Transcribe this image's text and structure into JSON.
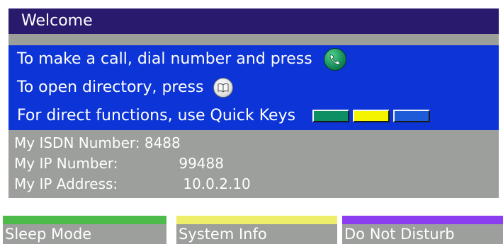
{
  "title": "Welcome",
  "instructions": {
    "call_text": "To make a call, dial number and press",
    "call_icon": "call-handset-icon",
    "directory_text": "To open directory, press",
    "directory_icon": "directory-book-icon",
    "quickkeys_text": "For direct functions, use Quick Keys",
    "quick_keys_colors": [
      "#0e8f63",
      "#f4f400",
      "#1d5bd8"
    ]
  },
  "info": {
    "isdn_label": "My ISDN Number:",
    "isdn_value": "8488",
    "ip_number_label": "My IP Number:",
    "ip_number_value": "99488",
    "ip_address_label": "My IP Address:",
    "ip_address_value": "10.0.2.10"
  },
  "softkeys": [
    {
      "label": "Sleep Mode",
      "color": "#4dbb4a"
    },
    {
      "label": "System Info",
      "color": "#eeee6a"
    },
    {
      "label": "Do Not Disturb",
      "color": "#8a3ef0"
    }
  ],
  "colors": {
    "title_bg": "#2a1a6e",
    "instructions_bg": "#0c34d6",
    "info_bg": "#9c9f9b"
  }
}
